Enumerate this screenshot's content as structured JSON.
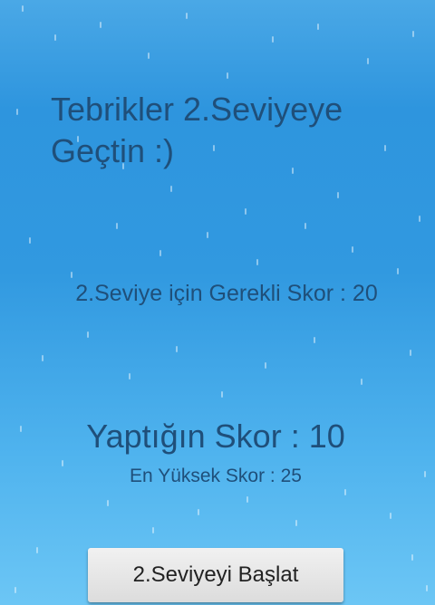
{
  "screen": {
    "title": "Tebrikler 2.Seviyeye Geçtin :)",
    "required_score_text": "2.Seviye için Gerekli Skor : 20",
    "your_score_text": "Yaptığın Skor : 10",
    "high_score_text": "En Yüksek Skor : 25",
    "start_button_label": "2.Seviyeyi Başlat"
  },
  "values": {
    "level": 2,
    "required_score": 20,
    "your_score": 10,
    "high_score": 25
  },
  "colors": {
    "text": "#1f4f7a",
    "background_top": "#2e95de",
    "background_bottom": "#6cc6f5",
    "button": "#e6e6e6"
  }
}
